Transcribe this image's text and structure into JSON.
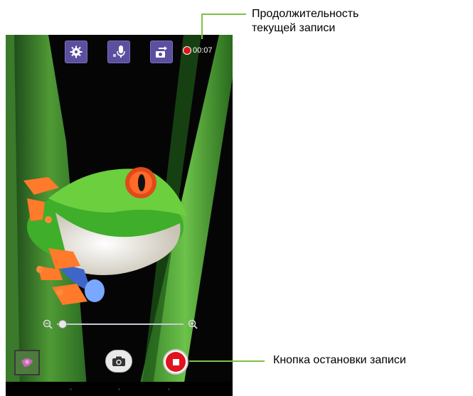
{
  "callouts": {
    "duration_line1": "Продолжительность",
    "duration_line2": "текущей записи",
    "stop_label": "Кнопка остановки записи"
  },
  "status": {
    "recording_time": "00:07"
  },
  "controls": {
    "settings_icon": "gear-icon",
    "mic_icon": "microphone-icon",
    "switch_camera_icon": "switch-camera-icon",
    "zoom_out_icon": "zoom-out-icon",
    "zoom_in_icon": "zoom-in-icon",
    "zoom_level": 0.0,
    "snapshot_icon": "camera-icon",
    "stop_icon": "stop-record-icon"
  },
  "colors": {
    "accent_callout": "#7cc242",
    "record_red": "#e0141e",
    "topbar_button": "#5b4fa0"
  }
}
